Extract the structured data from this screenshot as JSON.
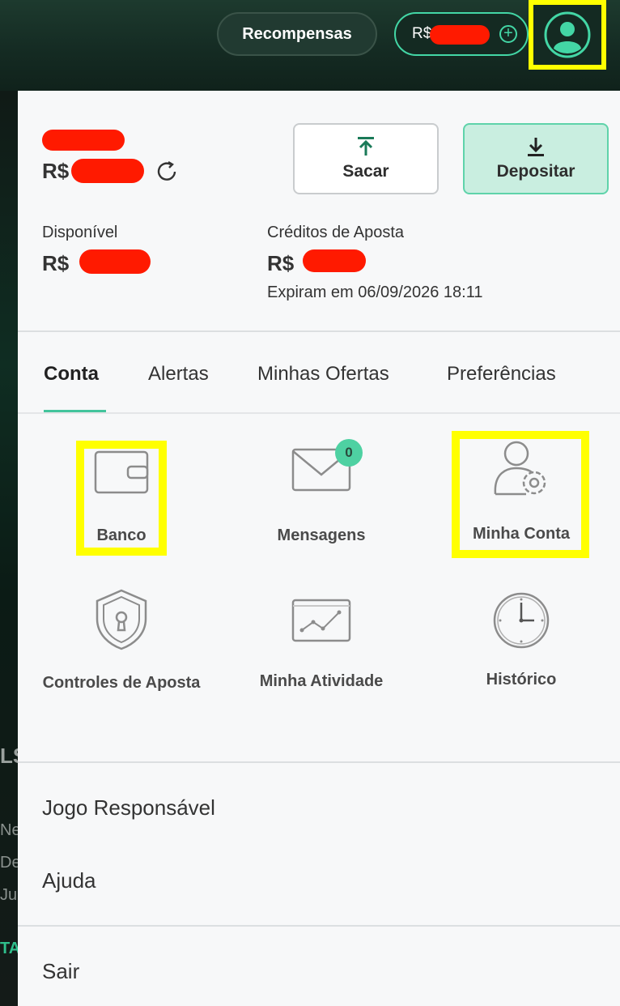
{
  "header": {
    "rewards_label": "Recompensas",
    "balance_prefix": "R$",
    "add_funds_symbol": "+"
  },
  "background_page": {
    "fragments": [
      "LS",
      "Ne",
      "De",
      "Ju",
      "TA"
    ]
  },
  "account": {
    "total_prefix": "R$",
    "withdraw_label": "Sacar",
    "deposit_label": "Depositar",
    "available_label": "Disponível",
    "available_prefix": "R$",
    "bet_credits_label": "Créditos de Aposta",
    "bet_credits_prefix": "R$",
    "expires_text": "Expiram em 06/09/2026 18:11"
  },
  "tabs": [
    {
      "label": "Conta",
      "active": true
    },
    {
      "label": "Alertas",
      "active": false
    },
    {
      "label": "Minhas Ofertas",
      "active": false
    },
    {
      "label": "Preferências",
      "active": false
    }
  ],
  "grid": [
    {
      "label": "Banco",
      "icon": "wallet-icon"
    },
    {
      "label": "Mensagens",
      "icon": "envelope-icon",
      "badge": "0"
    },
    {
      "label": "Minha Conta",
      "icon": "user-settings-icon"
    },
    {
      "label": "Controles de Aposta",
      "icon": "shield-lock-icon"
    },
    {
      "label": "Minha Atividade",
      "icon": "activity-chart-icon"
    },
    {
      "label": "Histórico",
      "icon": "clock-icon"
    }
  ],
  "links": {
    "responsible_gaming": "Jogo Responsável",
    "help": "Ajuda",
    "logout": "Sair"
  },
  "colors": {
    "accent": "#43d6a5",
    "highlight": "#ffff00",
    "redaction": "#ff1a00",
    "header_bg": "#142a22"
  }
}
